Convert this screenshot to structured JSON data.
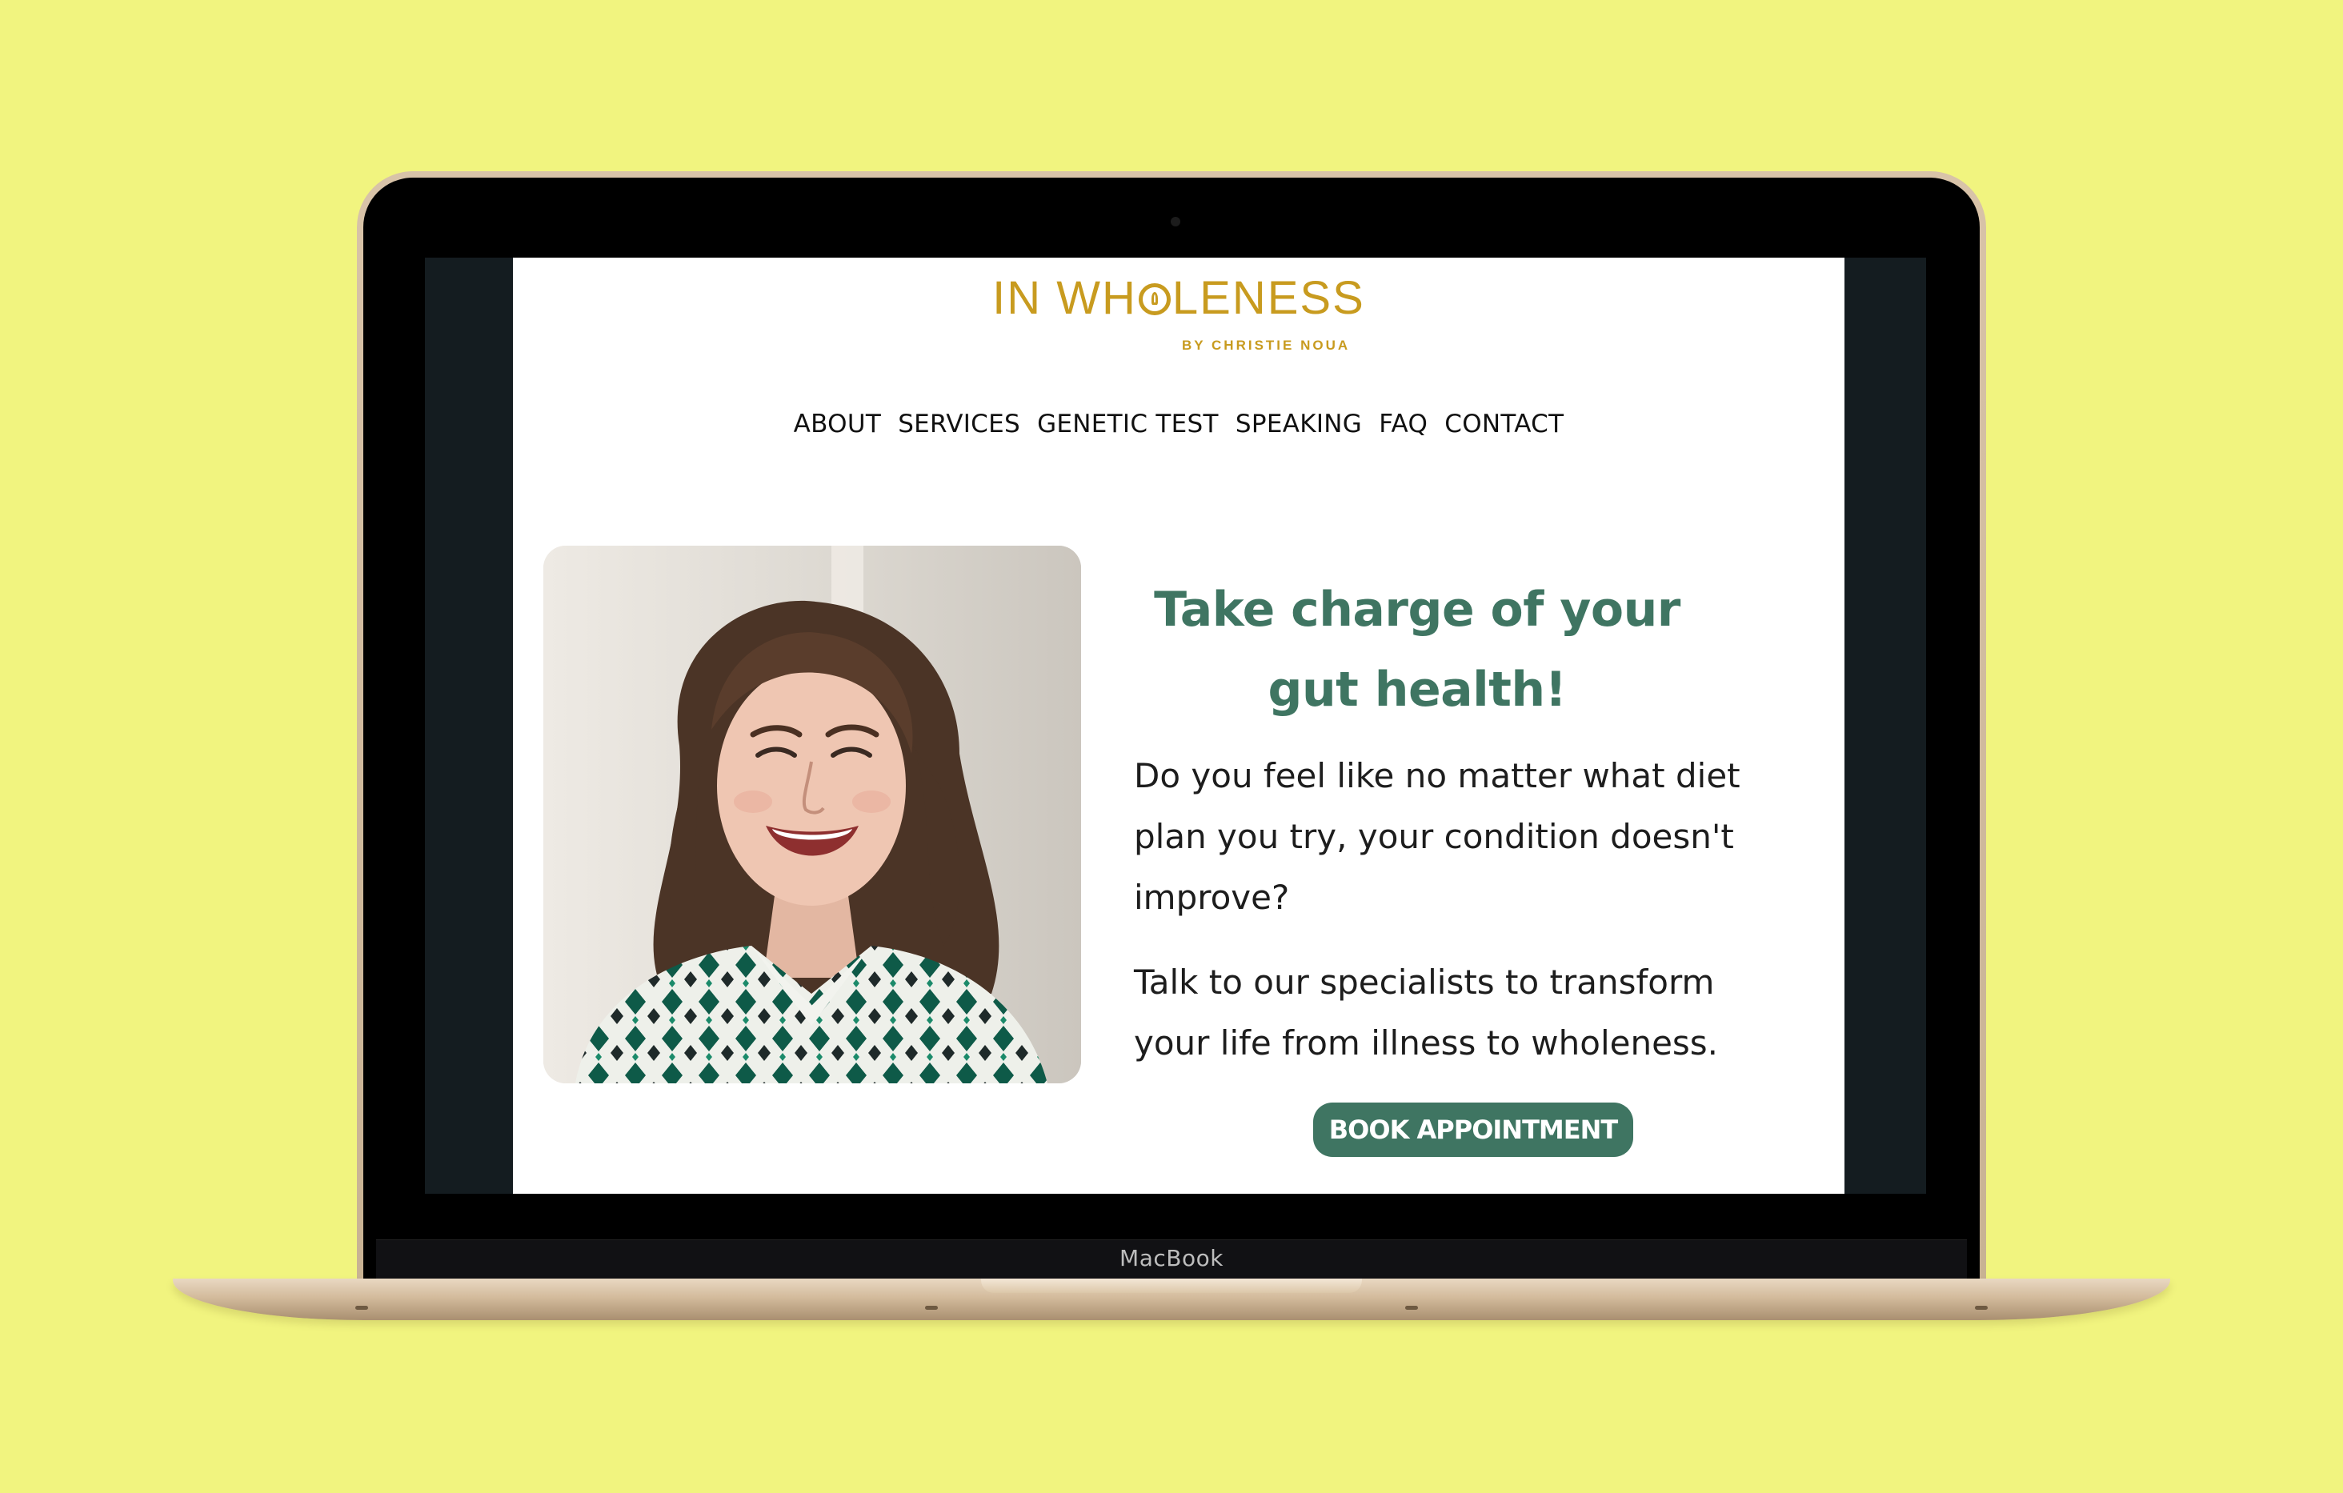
{
  "device": {
    "brand_label": "MacBook"
  },
  "site": {
    "logo": {
      "main_left": "IN WH",
      "main_right": "LENESS",
      "sub": "BY CHRISTIE NOUA"
    },
    "nav": {
      "items": [
        {
          "label": "ABOUT"
        },
        {
          "label": "SERVICES"
        },
        {
          "label": "GENETIC TEST"
        },
        {
          "label": "SPEAKING"
        },
        {
          "label": "FAQ"
        },
        {
          "label": "CONTACT"
        }
      ]
    },
    "hero": {
      "headline": "Take charge of your gut health!",
      "paragraph1": "Do you feel like no matter what diet plan you try, your condition doesn't improve?",
      "paragraph2": "Talk to our specialists to transform your life from illness to wholeness.",
      "cta_label": "BOOK APPOINTMENT"
    }
  },
  "colors": {
    "background": "#f1f47f",
    "brand_gold": "#c89b1f",
    "brand_green": "#3f7562"
  }
}
